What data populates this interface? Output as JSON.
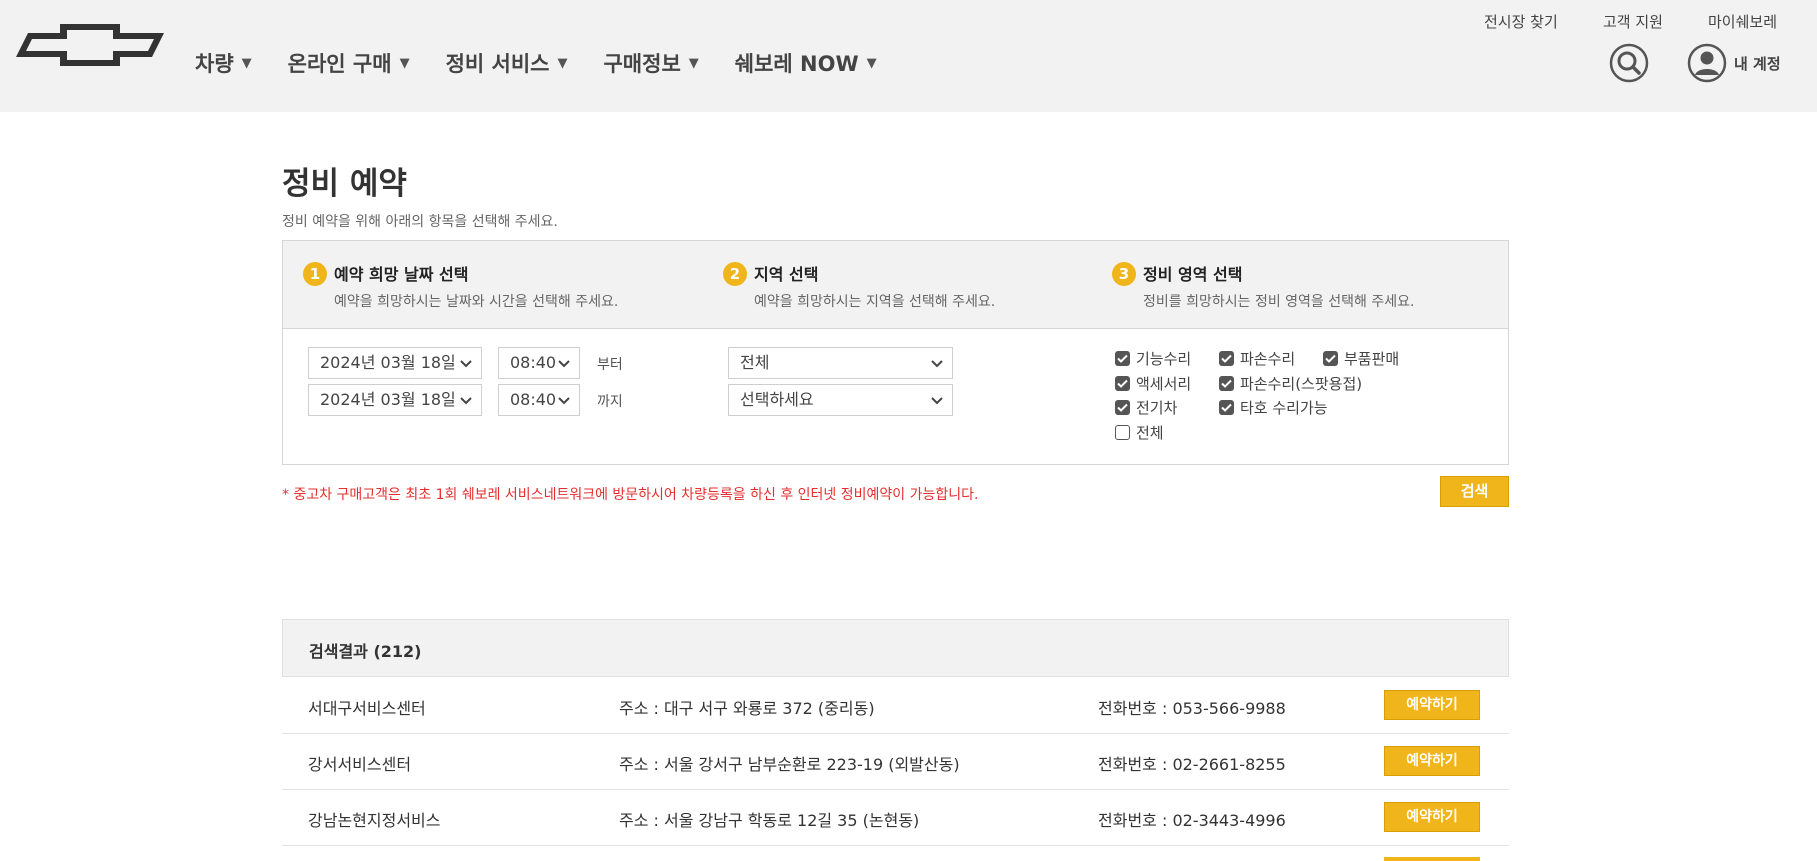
{
  "header": {
    "logo_icon": "chevrolet-bowtie-logo",
    "nav": [
      {
        "label": "차량"
      },
      {
        "label": "온라인 구매"
      },
      {
        "label": "정비 서비스"
      },
      {
        "label": "구매정보"
      },
      {
        "label": "쉐보레 NOW"
      }
    ],
    "caret": "▼",
    "util": {
      "find_showroom": "전시장 찾기",
      "customer_support": "고객 지원",
      "my_chevrolet": "마이쉐보레"
    },
    "search_icon": "search-icon",
    "account_label": "내 계정"
  },
  "page": {
    "title": "정비 예약",
    "description": "정비 예약을 위해 아래의 항목을 선택해 주세요."
  },
  "steps": [
    {
      "num": "1",
      "title": "예약 희망 날짜 선택",
      "desc": "예약을 희망하시는 날짜와 시간을 선택해 주세요."
    },
    {
      "num": "2",
      "title": "지역 선택",
      "desc": "예약을 희망하시는 지역을 선택해 주세요."
    },
    {
      "num": "3",
      "title": "정비 영역 선택",
      "desc": "정비를 희망하시는 정비 영역을 선택해 주세요."
    }
  ],
  "date_range": {
    "from_date": "2024년 03월 18일",
    "from_time": "08:40",
    "from_label": "부터",
    "to_date": "2024년 03월 18일",
    "to_time": "08:40",
    "to_label": "까지"
  },
  "region": {
    "primary": "전체",
    "secondary": "선택하세요"
  },
  "service_areas": [
    {
      "label": "기능수리",
      "checked": true
    },
    {
      "label": "파손수리",
      "checked": true
    },
    {
      "label": "부품판매",
      "checked": true
    },
    {
      "label": "액세서리",
      "checked": true
    },
    {
      "label": "파손수리(스팟용접)",
      "checked": true
    },
    {
      "label": "전기차",
      "checked": true
    },
    {
      "label": "타호 수리가능",
      "checked": true
    },
    {
      "label": "전체",
      "checked": false
    }
  ],
  "notice": "* 중고차 구매고객은 최초 1회 쉐보레 서비스네트워크에 방문하시어 차량등록을 하신 후 인터넷 정비예약이 가능합니다.",
  "search_button": "검색",
  "results": {
    "title": "검색결과 (212)",
    "reserve_label": "예약하기",
    "rows": [
      {
        "name": "서대구서비스센터",
        "address": "주소 : 대구 서구 와룡로 372 (중리동)",
        "phone": "전화번호 : 053-566-9988"
      },
      {
        "name": "강서서비스센터",
        "address": "주소 : 서울 강서구 남부순환로 223-19 (외발산동)",
        "phone": "전화번호 : 02-2661-8255"
      },
      {
        "name": "강남논현지정서비스",
        "address": "주소 : 서울 강남구 학동로 12길 35 (논현동)",
        "phone": "전화번호 : 02-3443-4996"
      }
    ]
  },
  "colors": {
    "accent": "#f0b51a",
    "notice": "#e52f2f",
    "header_bg": "#f2f2f2"
  }
}
